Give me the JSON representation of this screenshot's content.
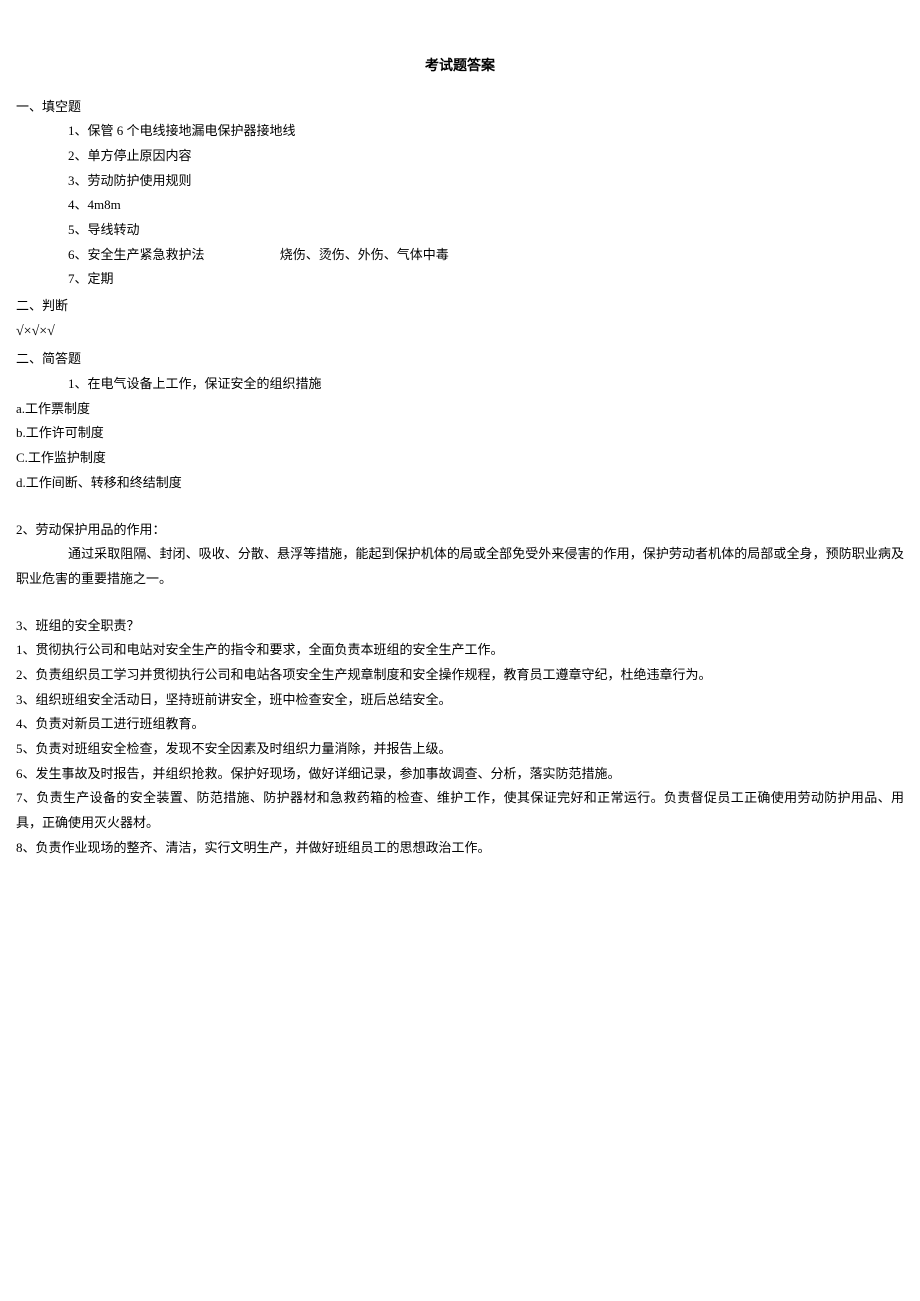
{
  "title": "考试题答案",
  "section1": {
    "heading": "一、填空题",
    "items": [
      "1、保管 6 个电线接地漏电保护器接地线",
      "2、单方停止原因内容",
      "3、劳动防护使用规则",
      "4、4m8m",
      "5、导线转动",
      "6、安全生产紧急救护法",
      "7、定期"
    ],
    "item6_extra": "烧伤、烫伤、外伤、气体中毒"
  },
  "section2": {
    "heading": "二、判断",
    "answers": "√×√×√"
  },
  "section3": {
    "heading": "二、简答题",
    "q1": {
      "title": "1、在电气设备上工作，保证安全的组织措施",
      "a": "a.工作票制度",
      "b": "b.工作许可制度",
      "c": "C.工作监护制度",
      "d": "d.工作间断、转移和终结制度"
    },
    "q2": {
      "title": "2、劳动保护用品的作用：",
      "content": "通过采取阻隔、封闭、吸收、分散、悬浮等措施，能起到保护机体的局或全部免受外来侵害的作用，保护劳动者机体的局部或全身，预防职业病及职业危害的重要措施之一。"
    },
    "q3": {
      "title": "3、班组的安全职责？",
      "items": [
        "1、贯彻执行公司和电站对安全生产的指令和要求，全面负责本班组的安全生产工作。",
        "2、负责组织员工学习并贯彻执行公司和电站各项安全生产规章制度和安全操作规程，教育员工遵章守纪，杜绝违章行为。",
        "3、组织班组安全活动日，坚持班前讲安全，班中检查安全，班后总结安全。",
        "4、负责对新员工进行班组教育。",
        "5、负责对班组安全检查，发现不安全因素及时组织力量消除，并报告上级。",
        "6、发生事故及时报告，并组织抢救。保护好现场，做好详细记录，参加事故调查、分析，落实防范措施。",
        "7、负责生产设备的安全装置、防范措施、防护器材和急救药箱的检查、维护工作，使其保证完好和正常运行。负责督促员工正确使用劳动防护用品、用具，正确使用灭火器材。",
        "8、负责作业现场的整齐、清洁，实行文明生产，并做好班组员工的思想政治工作。"
      ]
    }
  }
}
